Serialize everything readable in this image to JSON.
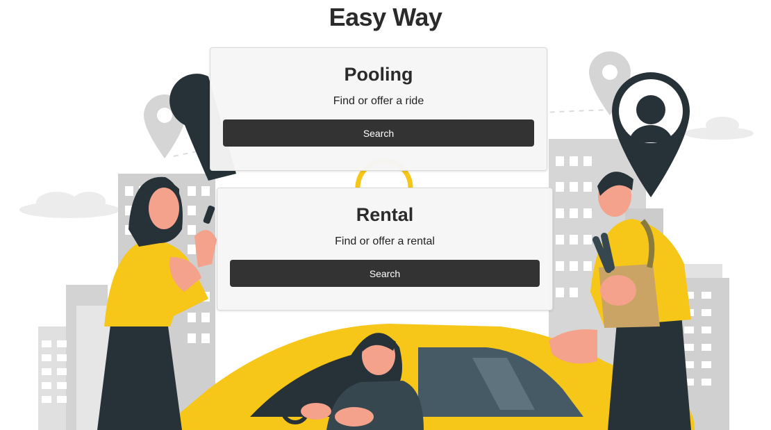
{
  "app": {
    "title": "Easy Way"
  },
  "cards": [
    {
      "title": "Pooling",
      "subtitle": "Find or offer a ride",
      "button_label": "Search"
    },
    {
      "title": "Rental",
      "subtitle": "Find or offer a rental",
      "button_label": "Search"
    }
  ],
  "colors": {
    "accent_yellow": "#F6C619",
    "button_bg": "#333333",
    "dark_teal": "#263238",
    "card_bg": "#F5F5F5"
  }
}
